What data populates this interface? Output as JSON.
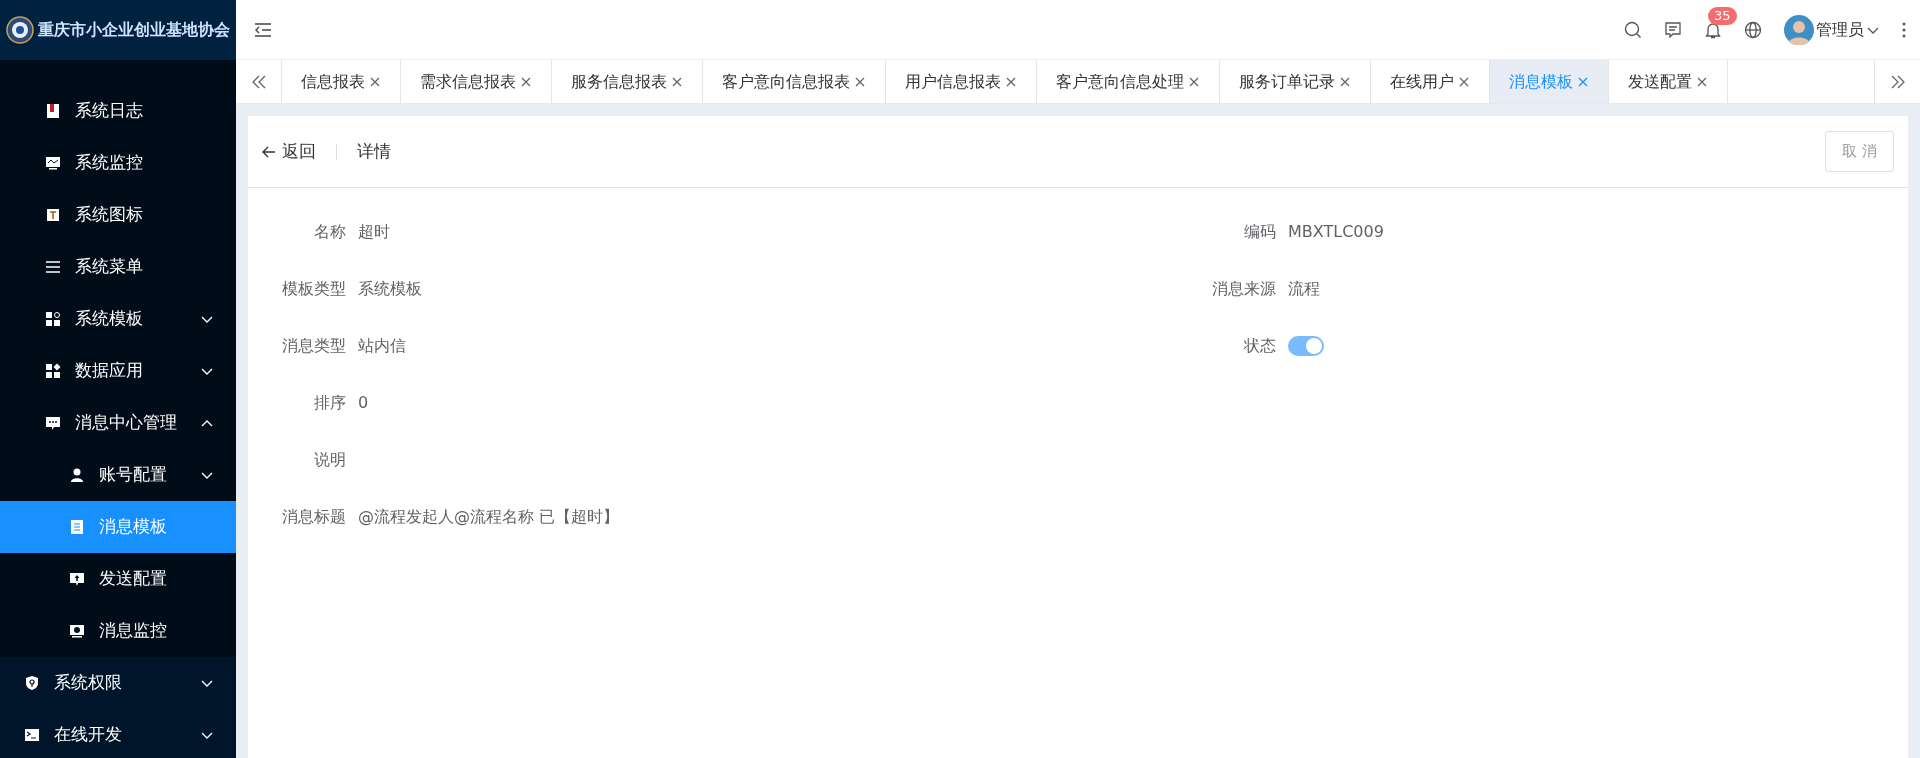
{
  "sidebar": {
    "title": "重庆市小企业创业基地协会",
    "submenu_items": [
      {
        "label": "系统日志",
        "kind": "link",
        "selected": false
      },
      {
        "label": "系统监控",
        "kind": "link",
        "selected": false
      },
      {
        "label": "系统图标",
        "kind": "link",
        "selected": false
      },
      {
        "label": "系统菜单",
        "kind": "link",
        "selected": false
      },
      {
        "label": "系统模板",
        "kind": "group",
        "expanded": false,
        "selected": false
      },
      {
        "label": "数据应用",
        "kind": "group",
        "expanded": false,
        "selected": false
      },
      {
        "label": "消息中心管理",
        "kind": "group",
        "expanded": true,
        "selected": false,
        "children": [
          {
            "label": "账号配置",
            "kind": "group",
            "expanded": false,
            "selected": false
          },
          {
            "label": "消息模板",
            "kind": "link",
            "selected": true
          },
          {
            "label": "发送配置",
            "kind": "link",
            "selected": false
          },
          {
            "label": "消息监控",
            "kind": "link",
            "selected": false
          }
        ]
      }
    ],
    "items": [
      {
        "label": "系统权限",
        "kind": "group",
        "expanded": false,
        "selected": false
      },
      {
        "label": "在线开发",
        "kind": "group",
        "expanded": false,
        "selected": false
      }
    ]
  },
  "header": {
    "notification_count": "35",
    "user_name": "管理员"
  },
  "tabs": [
    {
      "label": "信息报表",
      "selected": false
    },
    {
      "label": "需求信息报表",
      "selected": false
    },
    {
      "label": "服务信息报表",
      "selected": false
    },
    {
      "label": "客户意向信息报表",
      "selected": false
    },
    {
      "label": "用户信息报表",
      "selected": false
    },
    {
      "label": "客户意向信息处理",
      "selected": false
    },
    {
      "label": "服务订单记录",
      "selected": false
    },
    {
      "label": "在线用户",
      "selected": false
    },
    {
      "label": "消息模板",
      "selected": true
    },
    {
      "label": "发送配置",
      "selected": false
    }
  ],
  "detail": {
    "back": "返回",
    "title": "详情",
    "cancel": "取 消",
    "left_fields": [
      {
        "label": "名称",
        "kind": "text",
        "value": "超时"
      },
      {
        "label": "模板类型",
        "kind": "text",
        "value": "系统模板"
      },
      {
        "label": "消息类型",
        "kind": "text",
        "value": "站内信"
      },
      {
        "label": "排序",
        "kind": "text",
        "value": "0"
      },
      {
        "label": "说明",
        "kind": "text"
      },
      {
        "label": "消息标题",
        "kind": "text",
        "value": "@流程发起人@流程名称 已【超时】"
      }
    ],
    "right_fields": [
      {
        "label": "编码",
        "kind": "text",
        "value": "MBXTLC009"
      },
      {
        "label": "消息来源",
        "kind": "text",
        "value": "流程"
      },
      {
        "label": "状态",
        "kind": "switch",
        "on": true
      }
    ]
  }
}
